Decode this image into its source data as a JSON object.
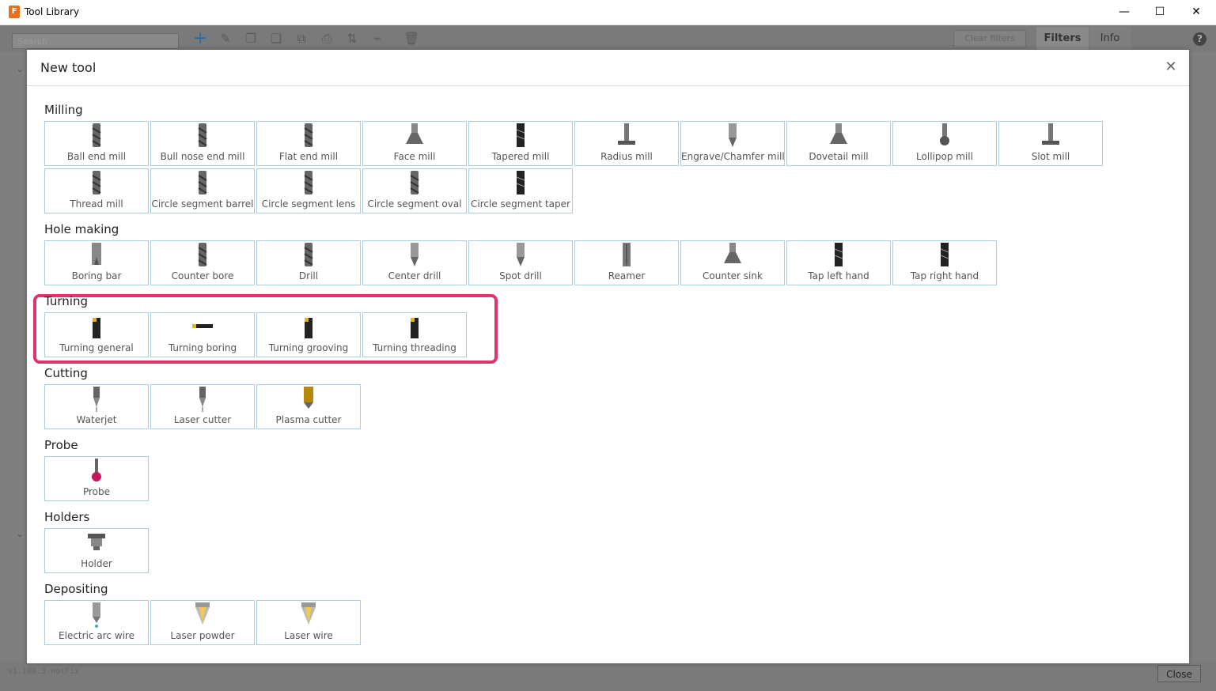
{
  "window": {
    "title": "Tool Library",
    "minimize": "—",
    "maximize": "☐",
    "close": "✕"
  },
  "toolbar": {
    "search_placeholder": "Search",
    "clear_filters": "Clear filters",
    "tab_filters": "Filters",
    "tab_info": "Info",
    "help": "?"
  },
  "status": {
    "version": "v1.100.3-HotFix",
    "close_label": "Close"
  },
  "dialog": {
    "title": "New tool",
    "close": "✕",
    "sections": {
      "milling": {
        "title": "Milling",
        "tools": [
          "Ball end mill",
          "Bull nose end mill",
          "Flat end mill",
          "Face mill",
          "Tapered mill",
          "Radius mill",
          "Engrave/Chamfer mill",
          "Dovetail mill",
          "Lollipop mill",
          "Slot mill",
          "Thread mill",
          "Circle segment barrel",
          "Circle segment lens",
          "Circle segment oval",
          "Circle segment taper"
        ]
      },
      "hole_making": {
        "title": "Hole making",
        "tools": [
          "Boring bar",
          "Counter bore",
          "Drill",
          "Center drill",
          "Spot drill",
          "Reamer",
          "Counter sink",
          "Tap left hand",
          "Tap right hand"
        ]
      },
      "turning": {
        "title": "Turning",
        "tools": [
          "Turning general",
          "Turning boring",
          "Turning grooving",
          "Turning threading"
        ]
      },
      "cutting": {
        "title": "Cutting",
        "tools": [
          "Waterjet",
          "Laser cutter",
          "Plasma cutter"
        ]
      },
      "probe": {
        "title": "Probe",
        "tools": [
          "Probe"
        ]
      },
      "holders": {
        "title": "Holders",
        "tools": [
          "Holder"
        ]
      },
      "depositing": {
        "title": "Depositing",
        "tools": [
          "Electric arc wire",
          "Laser powder",
          "Laser wire"
        ]
      }
    }
  },
  "colors": {
    "highlight": "#e0336a",
    "tile_border": "#a9cde3",
    "accent": "#2a6aa8"
  }
}
